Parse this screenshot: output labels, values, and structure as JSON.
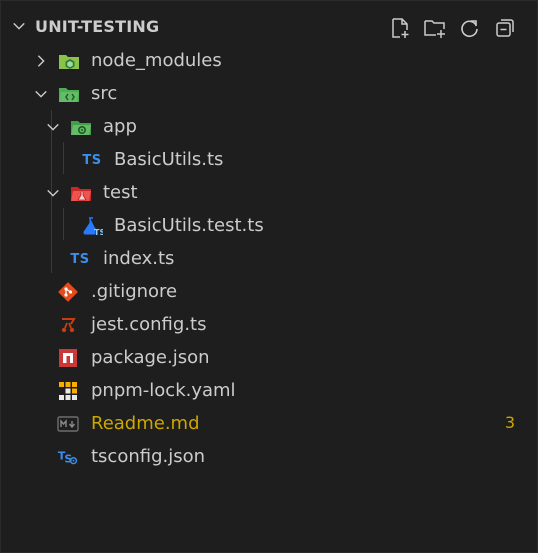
{
  "explorer": {
    "title": "UNIT-TESTING",
    "actions": [
      {
        "name": "new-file-icon"
      },
      {
        "name": "new-folder-icon"
      },
      {
        "name": "refresh-icon"
      },
      {
        "name": "collapse-all-icon"
      }
    ]
  },
  "tree": [
    {
      "label": "node_modules",
      "icon": "node-folder-icon",
      "expanded": false
    },
    {
      "label": "src",
      "icon": "src-folder-icon",
      "expanded": true
    },
    {
      "label": "app",
      "icon": "app-folder-icon",
      "expanded": true
    },
    {
      "label": "BasicUtils.ts",
      "icon": "typescript-icon",
      "badge_text": "TS"
    },
    {
      "label": "test",
      "icon": "test-folder-icon",
      "expanded": true
    },
    {
      "label": "BasicUtils.test.ts",
      "icon": "test-file-icon"
    },
    {
      "label": "index.ts",
      "icon": "typescript-icon",
      "badge_text": "TS"
    },
    {
      "label": ".gitignore",
      "icon": "git-icon"
    },
    {
      "label": "jest.config.ts",
      "icon": "jest-icon"
    },
    {
      "label": "package.json",
      "icon": "npm-icon"
    },
    {
      "label": "pnpm-lock.yaml",
      "icon": "pnpm-icon"
    },
    {
      "label": "Readme.md",
      "icon": "markdown-icon",
      "problems": "3",
      "status_color": "#cca700"
    },
    {
      "label": "tsconfig.json",
      "icon": "tsconfig-icon",
      "badge_text": "TS"
    }
  ]
}
